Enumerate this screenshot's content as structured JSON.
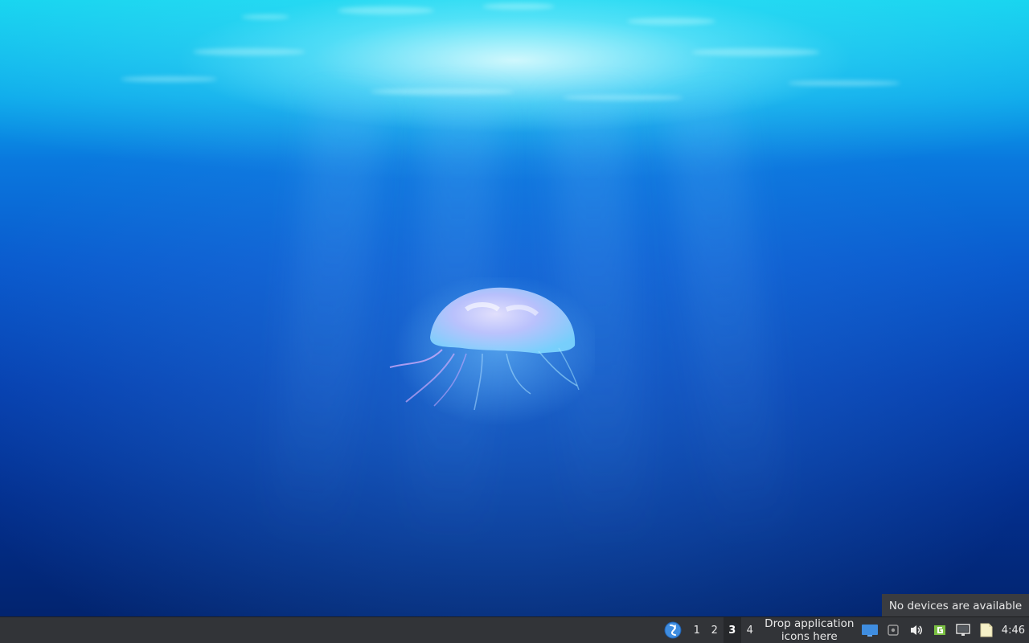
{
  "taskbar": {
    "workspaces": [
      "1",
      "2",
      "3",
      "4"
    ],
    "active_workspace": "3",
    "drop_area_line1": "Drop application",
    "drop_area_line2": "icons here",
    "clock": "4:46"
  },
  "tooltip": {
    "text": "No devices are available"
  },
  "icons": {
    "menu": "mint-logo-icon",
    "show_desktop": "monitor-icon",
    "removable_drives": "drive-icon",
    "volume": "speaker-icon",
    "update_manager": "shield-update-icon",
    "network": "network-icon",
    "notes": "notes-icon"
  },
  "colors": {
    "taskbar_bg": "#323438",
    "accent_blue": "#3f8de0",
    "update_green": "#7bc043"
  }
}
